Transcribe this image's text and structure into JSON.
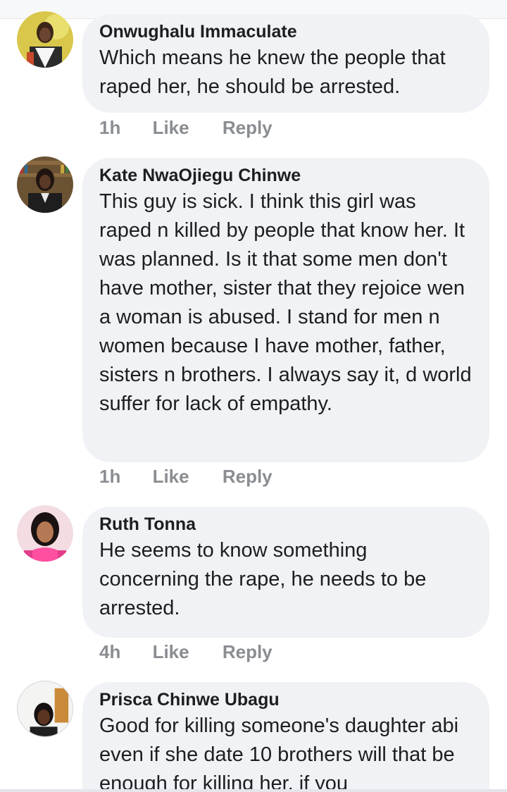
{
  "comments": [
    {
      "author": "Onwughalu Immaculate",
      "avatar": "woman-yellow-background-avatar",
      "text": "Which means he knew the people that raped her, he should be arrested.",
      "time": "1h",
      "like_label": "Like",
      "reply_label": "Reply"
    },
    {
      "author": "Kate NwaOjiegu Chinwe",
      "avatar": "woman-bookshelf-avatar",
      "text": "This guy is sick. I think this girl was raped n killed by people that know her. It was planned. Is it that some men don't have mother, sister that they rejoice wen a woman is abused. I stand for men n women because I have mother, father, sisters n brothers. I always say it, d world suffer for lack of empathy.",
      "time": "1h",
      "like_label": "Like",
      "reply_label": "Reply"
    },
    {
      "author": "Ruth Tonna",
      "avatar": "woman-pink-avatar",
      "text": "He seems to know something concerning the rape, he needs to be arrested.",
      "time": "4h",
      "like_label": "Like",
      "reply_label": "Reply"
    },
    {
      "author": "Prisca Chinwe Ubagu",
      "avatar": "woman-white-wall-avatar",
      "text": "Good for killing someone's daughter abi even if she date 10 brothers will that be enough for killing her, if you",
      "time": "",
      "like_label": "",
      "reply_label": ""
    }
  ],
  "colors": {
    "bubble": "#f0f2f5",
    "name": "#1c1e21",
    "meta": "#8a8d91"
  }
}
